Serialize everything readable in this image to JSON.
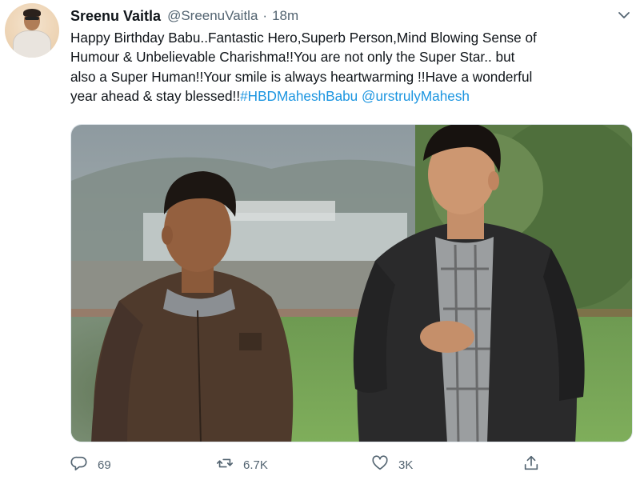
{
  "tweet": {
    "author": {
      "name": "Sreenu Vaitla",
      "handle": "@SreenuVaitla",
      "separator": "·",
      "time": "18m"
    },
    "text_lines": [
      {
        "plain": "Happy Birthday Babu..Fantastic Hero,Superb Person,Mind Blowing Sense of"
      },
      {
        "plain": "Humour & Unbelievable Charishma!!You are not only the Super Star.. but"
      },
      {
        "plain": "also a Super Human!!Your smile is always heartwarming !!Have a wonderful"
      },
      {
        "plain": "year ahead & stay blessed!!",
        "hashtag": "#HBDMaheshBabu",
        "mention": "@urstrulyMahesh"
      }
    ],
    "media": {
      "icon": "photo-two-men-walking-outdoors"
    },
    "actions": {
      "reply": {
        "icon": "reply-icon",
        "count": "69"
      },
      "retweet": {
        "icon": "retweet-icon",
        "count": "6.7K"
      },
      "like": {
        "icon": "heart-icon",
        "count": "3K"
      },
      "share": {
        "icon": "share-icon"
      }
    },
    "colors": {
      "link": "#1b95e0",
      "muted": "#536471",
      "text": "#0f1419"
    }
  }
}
